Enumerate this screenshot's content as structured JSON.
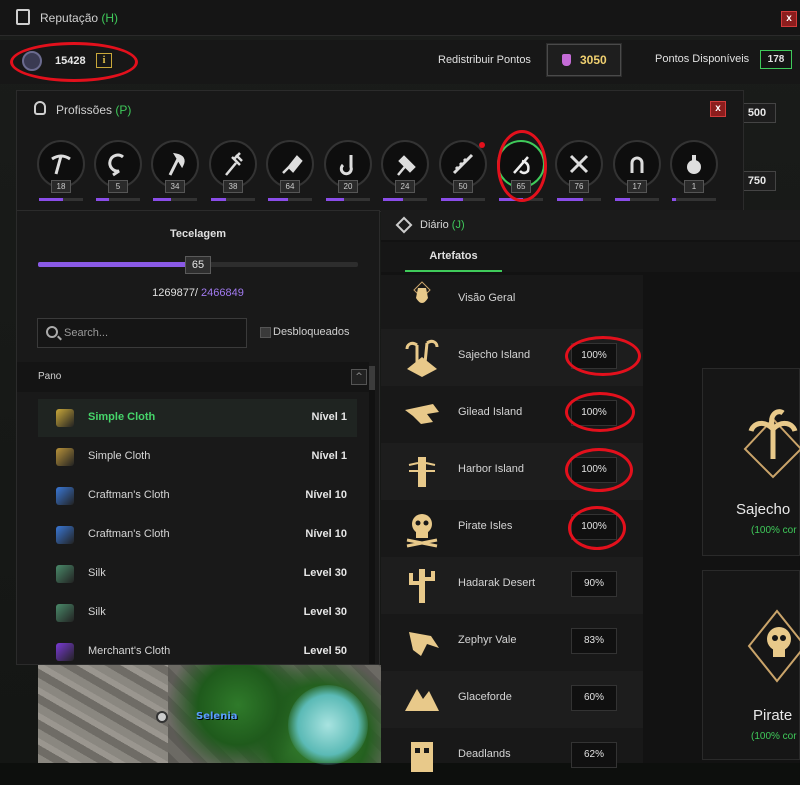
{
  "reputation": {
    "title": "Reputação",
    "hotkey": "(H)",
    "close": "x",
    "points": "15428",
    "info": "i",
    "redistribute_label": "Redistribuir Pontos",
    "redistribute_value": "3050",
    "available_label": "Pontos Disponíveis",
    "available_value": "178",
    "side_values": [
      "500",
      "750"
    ]
  },
  "professions": {
    "title": "Profissões",
    "hotkey": "(P)",
    "close": "x",
    "items": [
      {
        "name": "pickaxe",
        "level": "18",
        "progress": 0.55
      },
      {
        "name": "sickle",
        "level": "5",
        "progress": 0.3
      },
      {
        "name": "axe",
        "level": "34",
        "progress": 0.4
      },
      {
        "name": "pitchfork",
        "level": "38",
        "progress": 0.35
      },
      {
        "name": "cleaver",
        "level": "64",
        "progress": 0.45
      },
      {
        "name": "fishing-hook",
        "level": "20",
        "progress": 0.4
      },
      {
        "name": "hammer",
        "level": "24",
        "progress": 0.45
      },
      {
        "name": "saw",
        "level": "50",
        "progress": 0.5
      },
      {
        "name": "weaving-needle",
        "level": "65",
        "progress": 0.55
      },
      {
        "name": "crossed-tools",
        "level": "76",
        "progress": 0.6
      },
      {
        "name": "horseshoe",
        "level": "17",
        "progress": 0.35
      },
      {
        "name": "potion",
        "level": "1",
        "progress": 0.1
      }
    ]
  },
  "crafting": {
    "title": "Tecelagem",
    "level": "65",
    "level_progress": 0.47,
    "xp_current": "1269877/",
    "xp_max": " 2466849",
    "search_placeholder": "Search...",
    "unlocked_label": "Desbloqueados",
    "category": "Pano",
    "category_toggle": "^",
    "recipes": [
      {
        "name": "Simple Cloth",
        "level": "Nível 1",
        "color": "#c9a83a",
        "selected": true
      },
      {
        "name": "Simple Cloth",
        "level": "Nível 1",
        "color": "#b8923a",
        "selected": false
      },
      {
        "name": "Craftman's Cloth",
        "level": "Nível 10",
        "color": "#3a78d6",
        "selected": false
      },
      {
        "name": "Craftman's Cloth",
        "level": "Nível 10",
        "color": "#3a78d6",
        "selected": false
      },
      {
        "name": "Silk",
        "level": "Level 30",
        "color": "#4a8a6a",
        "selected": false
      },
      {
        "name": "Silk",
        "level": "Level 30",
        "color": "#4a8a6a",
        "selected": false
      },
      {
        "name": "Merchant's Cloth",
        "level": "Level 50",
        "color": "#7a3ad6",
        "selected": false
      }
    ]
  },
  "diary": {
    "title": "Diário",
    "hotkey": "(J)",
    "tab": "Artefatos",
    "entries": [
      {
        "name": "Visão Geral",
        "pct": "",
        "icon": "vase-icon"
      },
      {
        "name": "Sajecho Island",
        "pct": "100%",
        "icon": "palm-island-icon"
      },
      {
        "name": "Gilead Island",
        "pct": "100%",
        "icon": "crocodile-icon"
      },
      {
        "name": "Harbor Island",
        "pct": "100%",
        "icon": "lighthouse-icon"
      },
      {
        "name": "Pirate Isles",
        "pct": "100%",
        "icon": "skull-icon"
      },
      {
        "name": "Hadarak Desert",
        "pct": "90%",
        "icon": "cactus-icon"
      },
      {
        "name": "Zephyr Vale",
        "pct": "83%",
        "icon": "plague-mask-icon"
      },
      {
        "name": "Glaceforde",
        "pct": "60%",
        "icon": "mountain-icon"
      },
      {
        "name": "Deadlands",
        "pct": "62%",
        "icon": "totem-icon"
      }
    ]
  },
  "cards": [
    {
      "title": "Sajecho",
      "sub": "(100% cor"
    },
    {
      "title": "Pirate",
      "sub": "(100% cor"
    }
  ],
  "map": {
    "player_name": "Selenia"
  },
  "colors": {
    "accent_green": "#3fca5a",
    "accent_purple": "#8a5ae6",
    "highlight_red": "#e3101c",
    "gold": "#e7c64c"
  }
}
